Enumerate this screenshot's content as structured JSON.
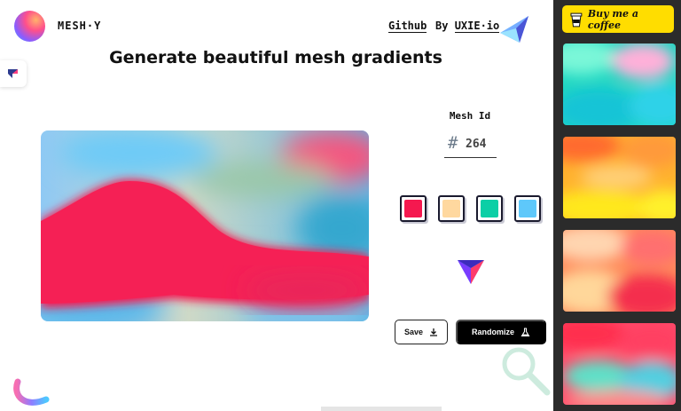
{
  "header": {
    "brand": "MESH·Y",
    "nav": {
      "github": "Github",
      "by_prefix": "By",
      "by_link": "UXIE·io"
    }
  },
  "main": {
    "headline": "Generate beautiful mesh gradients",
    "mesh_id": {
      "label": "Mesh Id",
      "hash": "#",
      "value": "264"
    },
    "swatches": [
      {
        "name": "swatch-red",
        "color": "#f5184f"
      },
      {
        "name": "swatch-peach",
        "color": "#ffd89f"
      },
      {
        "name": "swatch-teal",
        "color": "#0ccfa6"
      },
      {
        "name": "swatch-sky",
        "color": "#5ec8fa"
      }
    ],
    "buttons": {
      "save": "Save",
      "randomize": "Randomize"
    }
  },
  "sidebar": {
    "coffee_label": "Buy me a coffee",
    "thumbnails": [
      "teal-mesh",
      "orange-yellow-mesh",
      "peach-red-mesh",
      "red-teal-mesh"
    ]
  },
  "colors": {
    "accent_yellow": "#ffdd00",
    "sidebar_bg": "#2b2b2b",
    "primary_button": "#000000"
  }
}
